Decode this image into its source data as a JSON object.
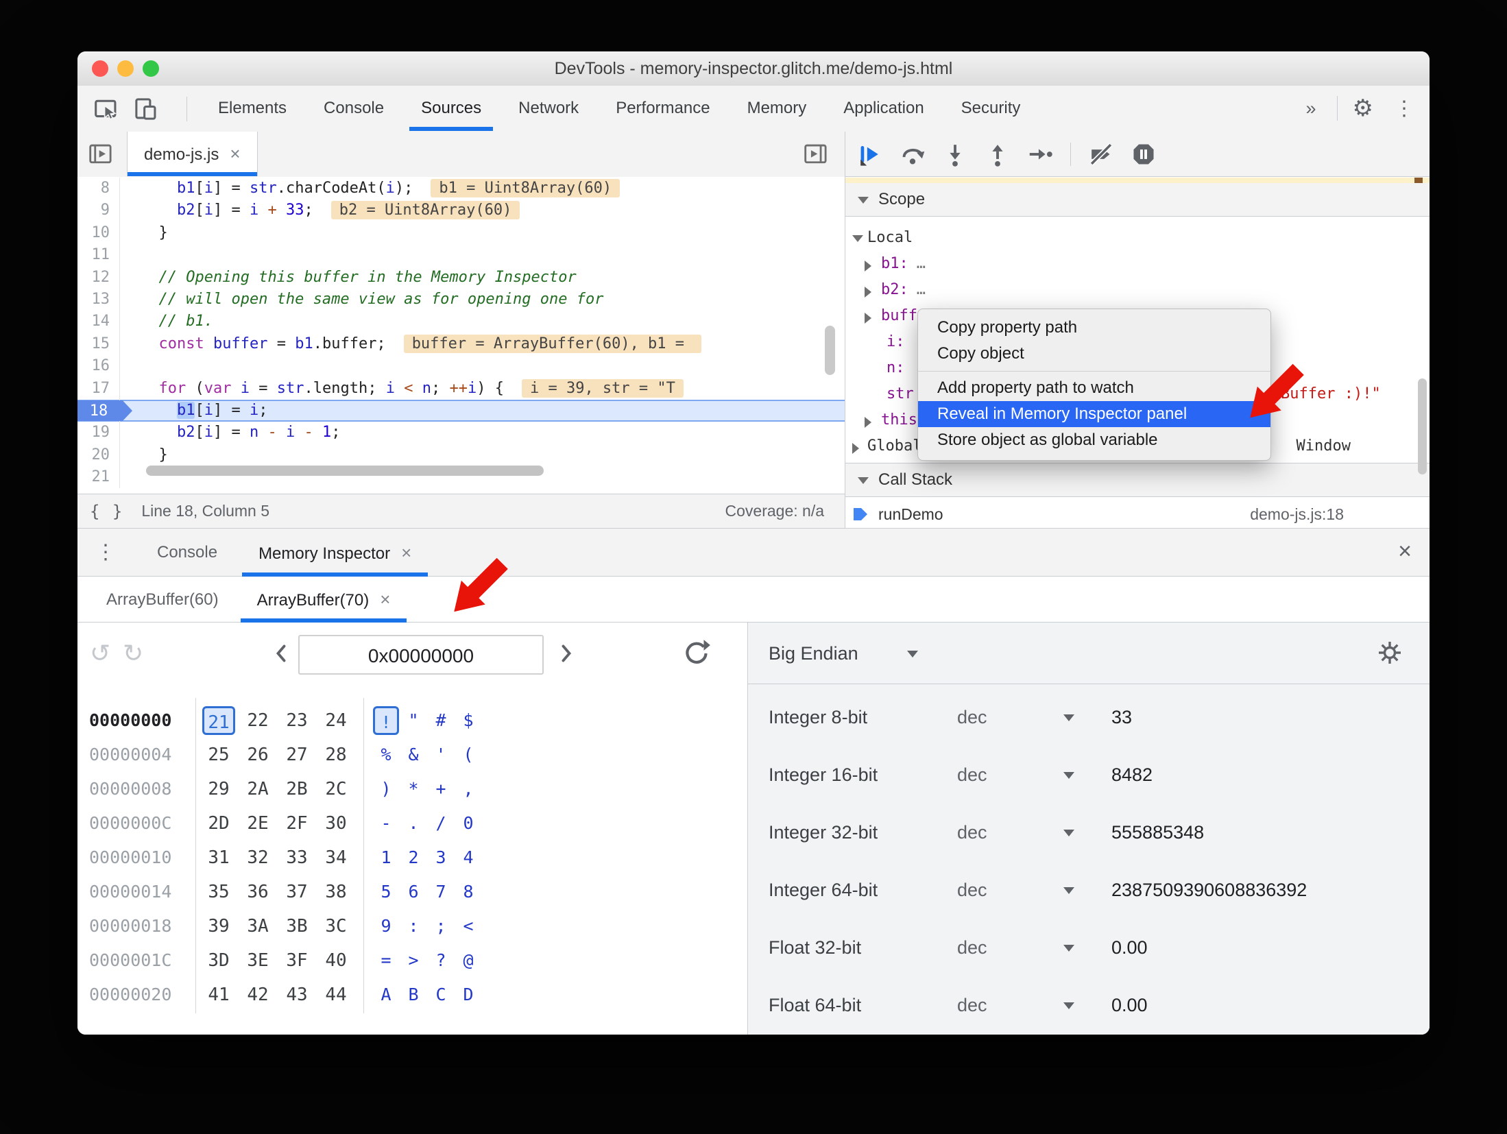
{
  "window": {
    "title": "DevTools - memory-inspector.glitch.me/demo-js.html"
  },
  "colors": {
    "accent_blue": "#1a73e8",
    "arrow_red": "#e81309",
    "menu_selection_blue": "#2a66f4",
    "traffic_close": "#fc5753",
    "traffic_minimize": "#fdbc40",
    "traffic_zoom": "#33c748"
  },
  "icons": {
    "gear": "⚙",
    "kebab": "⋮",
    "drawer_kebab": "⋮",
    "close": "×",
    "undo": "↺",
    "redo": "↻",
    "braces": "{ }",
    "ellipsis": "…"
  },
  "main_toolbar": {
    "tabs": [
      "Elements",
      "Console",
      "Sources",
      "Network",
      "Performance",
      "Memory",
      "Application",
      "Security"
    ],
    "active_tab": "Sources",
    "overflow_label": "»"
  },
  "sources_panel": {
    "file_tab": {
      "label": "demo-js.js",
      "close": "×"
    },
    "status_bar": {
      "position": "Line 18, Column 5",
      "coverage": "Coverage: n/a"
    },
    "code_lines": [
      {
        "num": "8",
        "indent": 4,
        "tokens": [
          [
            "b1",
            "v"
          ],
          [
            "[",
            "p"
          ],
          [
            "i",
            "v"
          ],
          [
            "] = ",
            "p"
          ],
          [
            "str",
            "v"
          ],
          [
            ".charCodeAt(",
            "p"
          ],
          [
            "i",
            "v"
          ],
          [
            ");",
            "p"
          ]
        ],
        "hint": "b1 = Uint8Array(60)"
      },
      {
        "num": "9",
        "indent": 4,
        "tokens": [
          [
            "b2",
            "v"
          ],
          [
            "[",
            "p"
          ],
          [
            "i",
            "v"
          ],
          [
            "] = ",
            "p"
          ],
          [
            "i",
            "v"
          ],
          [
            " ",
            "p"
          ],
          [
            "+",
            "o"
          ],
          [
            " ",
            "p"
          ],
          [
            "33",
            "n"
          ],
          [
            ";",
            "p"
          ]
        ],
        "hint": "b2 = Uint8Array(60)"
      },
      {
        "num": "10",
        "indent": 2,
        "tokens": [
          [
            "}",
            "p"
          ]
        ]
      },
      {
        "num": "11",
        "indent": 0,
        "tokens": []
      },
      {
        "num": "12",
        "indent": 2,
        "tokens": [
          [
            "// Opening this buffer in the Memory Inspector",
            "c"
          ]
        ]
      },
      {
        "num": "13",
        "indent": 2,
        "tokens": [
          [
            "// will open the same view as for opening one for",
            "c"
          ]
        ]
      },
      {
        "num": "14",
        "indent": 2,
        "tokens": [
          [
            "// b1.",
            "c"
          ]
        ]
      },
      {
        "num": "15",
        "indent": 2,
        "tokens": [
          [
            "const",
            "k"
          ],
          [
            " ",
            "p"
          ],
          [
            "buffer",
            "v"
          ],
          [
            " = ",
            "p"
          ],
          [
            "b1",
            "v"
          ],
          [
            ".buffer;",
            "p"
          ]
        ],
        "hint": "buffer = ArrayBuffer(60), b1 = "
      },
      {
        "num": "16",
        "indent": 0,
        "tokens": []
      },
      {
        "num": "17",
        "indent": 2,
        "tokens": [
          [
            "for",
            "k"
          ],
          [
            " (",
            "p"
          ],
          [
            "var",
            "k"
          ],
          [
            " ",
            "p"
          ],
          [
            "i",
            "v"
          ],
          [
            " = ",
            "p"
          ],
          [
            "str",
            "v"
          ],
          [
            ".length; ",
            "p"
          ],
          [
            "i",
            "v"
          ],
          [
            " ",
            "p"
          ],
          [
            "<",
            "o"
          ],
          [
            " ",
            "p"
          ],
          [
            "n",
            "v"
          ],
          [
            "; ",
            "p"
          ],
          [
            "++",
            "o"
          ],
          [
            "i",
            "v"
          ],
          [
            ") {",
            "p"
          ]
        ],
        "hint": "i = 39, str = \"T"
      },
      {
        "num": "18",
        "indent": 4,
        "current": true,
        "tokens": [
          [
            "b1",
            "vh"
          ],
          [
            "[",
            "p"
          ],
          [
            "i",
            "v"
          ],
          [
            "] = ",
            "p"
          ],
          [
            "i",
            "v"
          ],
          [
            ";",
            "p"
          ]
        ]
      },
      {
        "num": "19",
        "indent": 4,
        "tokens": [
          [
            "b2",
            "v"
          ],
          [
            "[",
            "p"
          ],
          [
            "i",
            "v"
          ],
          [
            "] = ",
            "p"
          ],
          [
            "n",
            "v"
          ],
          [
            " ",
            "p"
          ],
          [
            "-",
            "o"
          ],
          [
            " ",
            "p"
          ],
          [
            "i",
            "v"
          ],
          [
            " ",
            "p"
          ],
          [
            "-",
            "o"
          ],
          [
            " ",
            "p"
          ],
          [
            "1",
            "n"
          ],
          [
            ";",
            "p"
          ]
        ]
      },
      {
        "num": "20",
        "indent": 2,
        "tokens": [
          [
            "}",
            "p"
          ]
        ]
      },
      {
        "num": "21",
        "indent": 0,
        "tokens": []
      }
    ]
  },
  "debugger_sidebar": {
    "scope_title": "Scope",
    "call_stack_title": "Call Stack",
    "scope_rows": [
      {
        "caret": "expanded",
        "label": "Local",
        "type": "section"
      },
      {
        "caret": "collapsed",
        "label": "b1",
        "type": "var",
        "value": "…"
      },
      {
        "caret": "collapsed",
        "label": "b2",
        "type": "var",
        "value": "…"
      },
      {
        "caret": "collapsed",
        "label": "buffer",
        "type": "var"
      },
      {
        "label": "i",
        "type": "var"
      },
      {
        "label": "n",
        "type": "var"
      },
      {
        "label": "str",
        "type": "var",
        "value": "Buffer :)!\"",
        "value_style": "string-fragment"
      },
      {
        "caret": "collapsed",
        "label": "this",
        "type": "var"
      },
      {
        "caret": "collapsed",
        "label": "Global",
        "type": "section",
        "value": "Window",
        "value_style": "right"
      }
    ],
    "call_stack_frame": {
      "name": "runDemo",
      "location": "demo-js.js:18"
    }
  },
  "context_menu": {
    "groups": [
      [
        "Copy property path",
        "Copy object"
      ],
      [
        "Add property path to watch",
        "Reveal in Memory Inspector panel",
        "Store object as global variable"
      ]
    ],
    "selected": "Reveal in Memory Inspector panel"
  },
  "drawer": {
    "tabs": [
      {
        "label": "Console",
        "active": false
      },
      {
        "label": "Memory Inspector",
        "close": "×",
        "active": true
      }
    ],
    "buffer_tabs": [
      {
        "label": "ArrayBuffer(60)",
        "active": false
      },
      {
        "label": "ArrayBuffer(70)",
        "close": "×",
        "active": true
      }
    ]
  },
  "memory_inspector": {
    "address_input": "0x00000000",
    "hex_rows": [
      {
        "addr": "00000000",
        "hex": [
          "21",
          "22",
          "23",
          "24"
        ],
        "ascii": [
          "!",
          "\"",
          "#",
          "$"
        ],
        "selected_col": 0,
        "addr_active": true
      },
      {
        "addr": "00000004",
        "hex": [
          "25",
          "26",
          "27",
          "28"
        ],
        "ascii": [
          "%",
          "&",
          "'",
          "("
        ]
      },
      {
        "addr": "00000008",
        "hex": [
          "29",
          "2A",
          "2B",
          "2C"
        ],
        "ascii": [
          ")",
          "*",
          "+",
          ","
        ]
      },
      {
        "addr": "0000000C",
        "hex": [
          "2D",
          "2E",
          "2F",
          "30"
        ],
        "ascii": [
          "-",
          ".",
          "/",
          "0"
        ]
      },
      {
        "addr": "00000010",
        "hex": [
          "31",
          "32",
          "33",
          "34"
        ],
        "ascii": [
          "1",
          "2",
          "3",
          "4"
        ]
      },
      {
        "addr": "00000014",
        "hex": [
          "35",
          "36",
          "37",
          "38"
        ],
        "ascii": [
          "5",
          "6",
          "7",
          "8"
        ]
      },
      {
        "addr": "00000018",
        "hex": [
          "39",
          "3A",
          "3B",
          "3C"
        ],
        "ascii": [
          "9",
          ":",
          ";",
          "<"
        ]
      },
      {
        "addr": "0000001C",
        "hex": [
          "3D",
          "3E",
          "3F",
          "40"
        ],
        "ascii": [
          "=",
          ">",
          "?",
          "@"
        ]
      },
      {
        "addr": "00000020",
        "hex": [
          "41",
          "42",
          "43",
          "44"
        ],
        "ascii": [
          "A",
          "B",
          "C",
          "D"
        ]
      }
    ],
    "interpreter": {
      "endianness": "Big Endian",
      "rows": [
        {
          "label": "Integer 8-bit",
          "format": "dec",
          "value": "33"
        },
        {
          "label": "Integer 16-bit",
          "format": "dec",
          "value": "8482"
        },
        {
          "label": "Integer 32-bit",
          "format": "dec",
          "value": "555885348"
        },
        {
          "label": "Integer 64-bit",
          "format": "dec",
          "value": "2387509390608836392"
        },
        {
          "label": "Float 32-bit",
          "format": "dec",
          "value": "0.00"
        },
        {
          "label": "Float 64-bit",
          "format": "dec",
          "value": "0.00"
        }
      ]
    }
  }
}
